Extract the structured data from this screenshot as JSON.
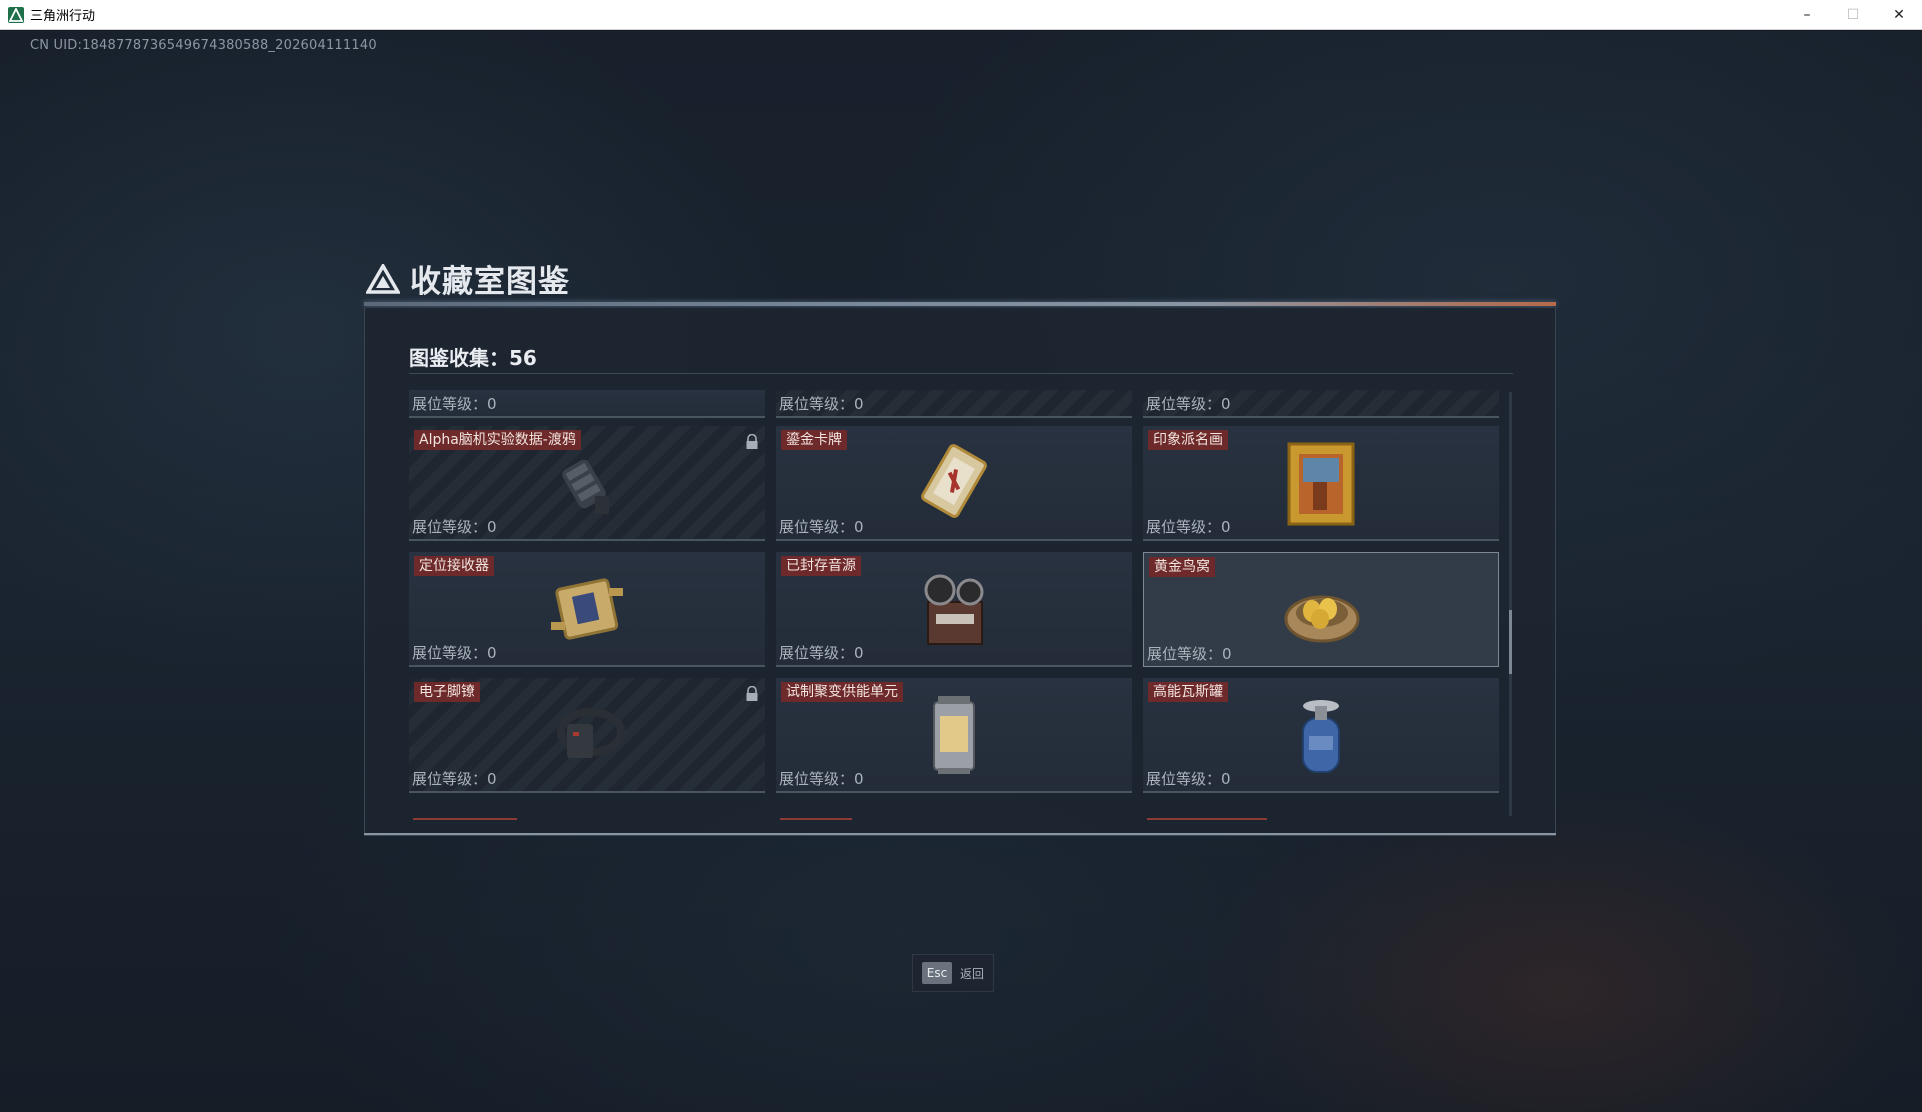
{
  "window": {
    "title": "三角洲行动",
    "minimize": "–",
    "maximize": "☐",
    "close": "✕"
  },
  "uid": "CN UID:1848778736549674380588_202604111140",
  "panel": {
    "title": "收藏室图鉴",
    "collect_count": "图鉴收集：56"
  },
  "top_row": [
    {
      "level": "展位等级：0"
    },
    {
      "level": "展位等级：0"
    },
    {
      "level": "展位等级：0"
    }
  ],
  "cards": [
    {
      "name": "Alpha脑机实验数据-渡鸦",
      "level": "展位等级：0",
      "locked": true,
      "icon": "brain-device-icon"
    },
    {
      "name": "鎏金卡牌",
      "level": "展位等级：0",
      "locked": false,
      "icon": "gold-card-icon"
    },
    {
      "name": "印象派名画",
      "level": "展位等级：0",
      "locked": false,
      "icon": "painting-icon"
    },
    {
      "name": "定位接收器",
      "level": "展位等级：0",
      "locked": false,
      "icon": "receiver-icon"
    },
    {
      "name": "已封存音源",
      "level": "展位等级：0",
      "locked": false,
      "icon": "reel-recorder-icon"
    },
    {
      "name": "黄金鸟窝",
      "level": "展位等级：0",
      "locked": false,
      "icon": "golden-nest-icon"
    },
    {
      "name": "电子脚镣",
      "level": "展位等级：0",
      "locked": true,
      "icon": "ankle-monitor-icon"
    },
    {
      "name": "试制聚变供能单元",
      "level": "展位等级：0",
      "locked": false,
      "icon": "fusion-unit-icon"
    },
    {
      "name": "高能瓦斯罐",
      "level": "展位等级：0",
      "locked": false,
      "icon": "gas-canister-icon"
    }
  ],
  "esc": {
    "key": "Esc",
    "label": "返回"
  }
}
